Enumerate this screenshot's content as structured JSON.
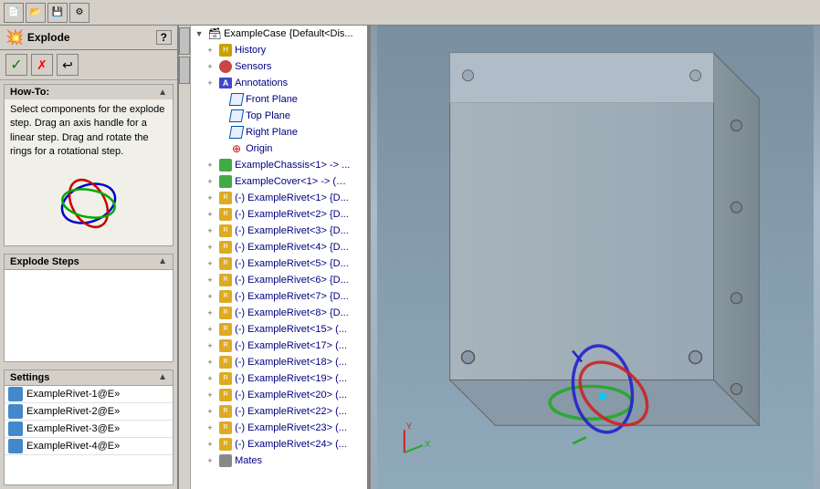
{
  "toolbar": {
    "buttons": [
      "new",
      "open",
      "save",
      "options"
    ]
  },
  "left_panel": {
    "title": "Explode",
    "help_icon": "?",
    "actions": {
      "confirm": "✓",
      "cancel": "✗",
      "undo": "↩"
    },
    "howto": {
      "title": "How-To:",
      "text": "Select components for the explode step. Drag an axis handle for a linear step. Drag and rotate the rings for a rotational step."
    },
    "explode_steps": {
      "title": "Explode Steps"
    },
    "settings": {
      "title": "Settings",
      "items": [
        "ExampleRivet-1@E»",
        "ExampleRivet-2@E»",
        "ExampleRivet-3@E»",
        "ExampleRivet-4@E»"
      ]
    }
  },
  "tree": {
    "root": "ExampleCase {Default<Dis...",
    "items": [
      {
        "label": "History",
        "indent": 1,
        "expandable": true,
        "icon": "history"
      },
      {
        "label": "Sensors",
        "indent": 1,
        "expandable": true,
        "icon": "sensor"
      },
      {
        "label": "Annotations",
        "indent": 1,
        "expandable": true,
        "icon": "annotation"
      },
      {
        "label": "Front Plane",
        "indent": 2,
        "expandable": false,
        "icon": "plane"
      },
      {
        "label": "Top Plane",
        "indent": 2,
        "expandable": false,
        "icon": "plane"
      },
      {
        "label": "Right Plane",
        "indent": 2,
        "expandable": false,
        "icon": "plane"
      },
      {
        "label": "Origin",
        "indent": 2,
        "expandable": false,
        "icon": "origin"
      },
      {
        "label": "ExampleChassis<1> -> ...",
        "indent": 1,
        "expandable": true,
        "icon": "component"
      },
      {
        "label": "ExampleCover<1> -> (…",
        "indent": 1,
        "expandable": true,
        "icon": "component"
      },
      {
        "label": "(-) ExampleRivet<1> {D...",
        "indent": 1,
        "expandable": true,
        "icon": "rivet",
        "disabled": true
      },
      {
        "label": "(-) ExampleRivet<2> {D...",
        "indent": 1,
        "expandable": true,
        "icon": "rivet",
        "disabled": true
      },
      {
        "label": "(-) ExampleRivet<3> {D...",
        "indent": 1,
        "expandable": true,
        "icon": "rivet",
        "disabled": true
      },
      {
        "label": "(-) ExampleRivet<4> {D...",
        "indent": 1,
        "expandable": true,
        "icon": "rivet",
        "disabled": true
      },
      {
        "label": "(-) ExampleRivet<5> {D...",
        "indent": 1,
        "expandable": true,
        "icon": "rivet",
        "disabled": true
      },
      {
        "label": "(-) ExampleRivet<6> {D...",
        "indent": 1,
        "expandable": true,
        "icon": "rivet",
        "disabled": true
      },
      {
        "label": "(-) ExampleRivet<7> {D...",
        "indent": 1,
        "expandable": true,
        "icon": "rivet",
        "disabled": true
      },
      {
        "label": "(-) ExampleRivet<8> {D...",
        "indent": 1,
        "expandable": true,
        "icon": "rivet",
        "disabled": true
      },
      {
        "label": "(-) ExampleRivet<15> (...",
        "indent": 1,
        "expandable": true,
        "icon": "rivet",
        "disabled": true
      },
      {
        "label": "(-) ExampleRivet<17> (...",
        "indent": 1,
        "expandable": true,
        "icon": "rivet",
        "disabled": true
      },
      {
        "label": "(-) ExampleRivet<18> (...",
        "indent": 1,
        "expandable": true,
        "icon": "rivet",
        "disabled": true
      },
      {
        "label": "(-) ExampleRivet<19> (...",
        "indent": 1,
        "expandable": true,
        "icon": "rivet",
        "disabled": true
      },
      {
        "label": "(-) ExampleRivet<20> (...",
        "indent": 1,
        "expandable": true,
        "icon": "rivet",
        "disabled": true
      },
      {
        "label": "(-) ExampleRivet<22> (...",
        "indent": 1,
        "expandable": true,
        "icon": "rivet",
        "disabled": true
      },
      {
        "label": "(-) ExampleRivet<23> (...",
        "indent": 1,
        "expandable": true,
        "icon": "rivet",
        "disabled": true
      },
      {
        "label": "(-) ExampleRivet<24> (...",
        "indent": 1,
        "expandable": true,
        "icon": "rivet",
        "disabled": true
      },
      {
        "label": "Mates",
        "indent": 1,
        "expandable": true,
        "icon": "mates"
      }
    ]
  },
  "viewport": {
    "background_top": "#8899aa",
    "background_bottom": "#99aabb"
  }
}
